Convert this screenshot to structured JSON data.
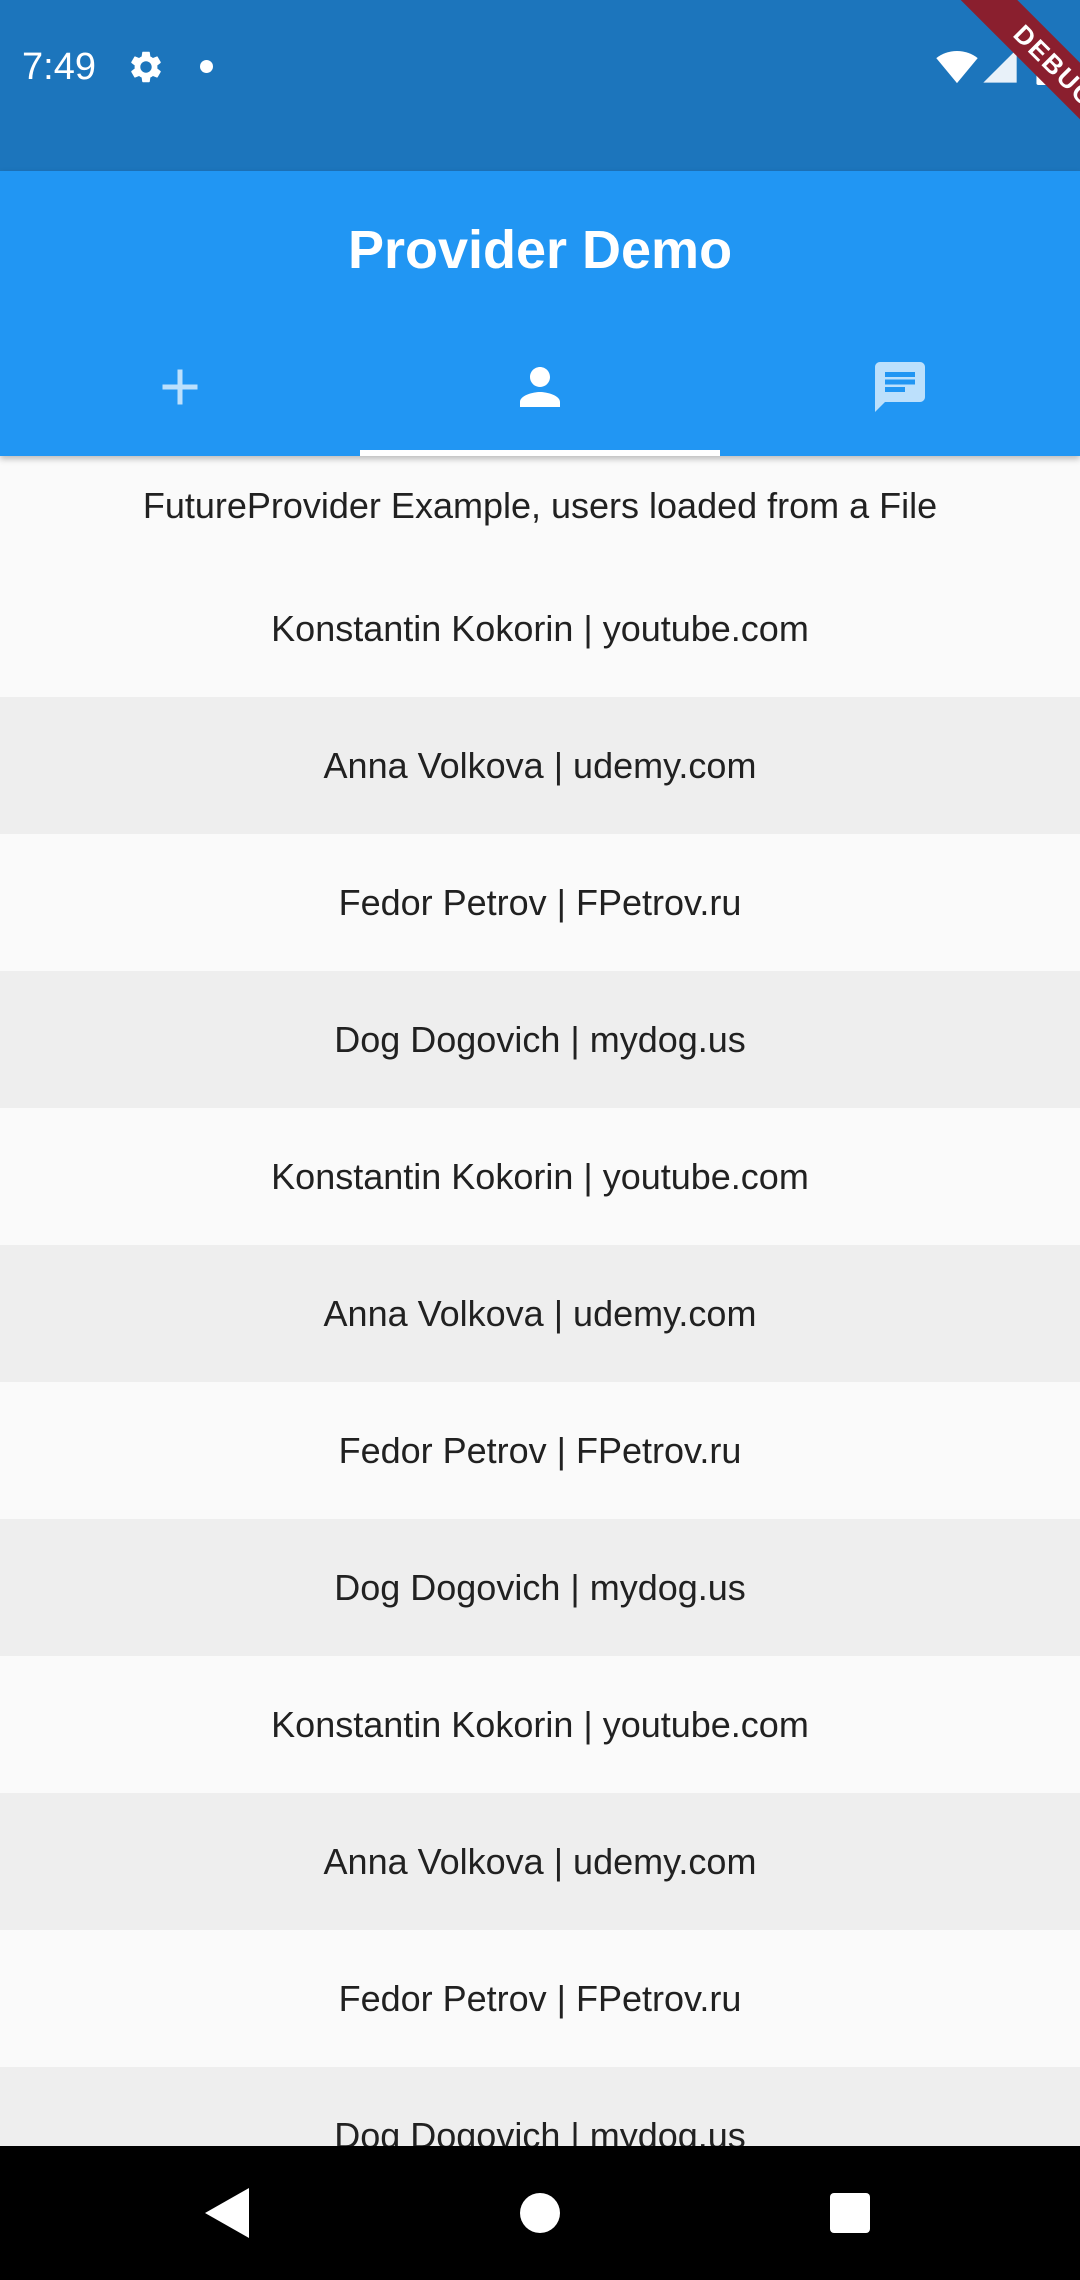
{
  "status_bar": {
    "time": "7:49",
    "icons": [
      "gear-icon",
      "notification-dot-icon",
      "wifi-icon",
      "signal-icon",
      "battery-icon"
    ]
  },
  "debug_banner": {
    "label": "DEBUG"
  },
  "app_bar": {
    "title": "Provider Demo",
    "background_color": "#2196f3",
    "tabs": [
      {
        "icon": "add-icon",
        "label": "Add",
        "selected": false
      },
      {
        "icon": "person-icon",
        "label": "Users",
        "selected": true
      },
      {
        "icon": "message-icon",
        "label": "Messages",
        "selected": false
      }
    ]
  },
  "content": {
    "header": "FutureProvider Example, users loaded from a File",
    "users": [
      "Konstantin Kokorin | youtube.com",
      "Anna Volkova | udemy.com",
      "Fedor Petrov | FPetrov.ru",
      "Dog Dogovich | mydog.us",
      "Konstantin Kokorin | youtube.com",
      "Anna Volkova | udemy.com",
      "Fedor Petrov | FPetrov.ru",
      "Dog Dogovich | mydog.us",
      "Konstantin Kokorin | youtube.com",
      "Anna Volkova | udemy.com",
      "Fedor Petrov | FPetrov.ru",
      "Dog Dogovich | mydog.us"
    ]
  },
  "nav_bar": {
    "buttons": [
      "back-icon",
      "home-icon",
      "recents-icon"
    ]
  }
}
